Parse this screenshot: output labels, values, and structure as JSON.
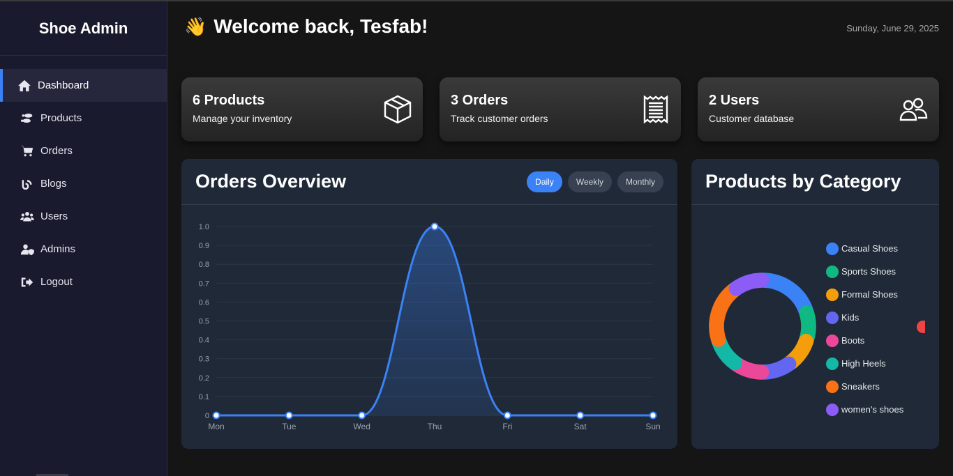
{
  "sidebar": {
    "brand": "Shoe Admin",
    "items": [
      {
        "label": "Dashboard",
        "icon": "home-icon"
      },
      {
        "label": "Products",
        "icon": "shoe-prints-icon"
      },
      {
        "label": "Orders",
        "icon": "cart-icon"
      },
      {
        "label": "Blogs",
        "icon": "blog-icon"
      },
      {
        "label": "Users",
        "icon": "users-icon"
      },
      {
        "label": "Admins",
        "icon": "user-shield-icon"
      },
      {
        "label": "Logout",
        "icon": "logout-icon"
      }
    ],
    "active": "Dashboard"
  },
  "header": {
    "wave": "👋",
    "welcome": "Welcome back, Tesfab!",
    "date": "Sunday, June 29, 2025"
  },
  "stats": [
    {
      "title": "6 Products",
      "subtitle": "Manage your inventory",
      "icon": "box-icon"
    },
    {
      "title": "3 Orders",
      "subtitle": "Track customer orders",
      "icon": "receipt-icon"
    },
    {
      "title": "2 Users",
      "subtitle": "Customer database",
      "icon": "users-outline-icon"
    }
  ],
  "orders": {
    "title": "Orders Overview",
    "tabs": [
      "Daily",
      "Weekly",
      "Monthly"
    ],
    "active_tab": "Daily"
  },
  "category": {
    "title": "Products by Category"
  },
  "colors": {
    "accent": "#3b82f6",
    "card": "#1f2937",
    "line": "#3b82f6"
  },
  "chart_data": [
    {
      "type": "line",
      "categories": [
        "Mon",
        "Tue",
        "Wed",
        "Thu",
        "Fri",
        "Sat",
        "Sun"
      ],
      "series": [
        {
          "values": [
            0,
            0,
            0,
            1,
            0,
            0,
            0
          ]
        }
      ],
      "yticks": [
        "0",
        "0.1",
        "0.2",
        "0.3",
        "0.4",
        "0.5",
        "0.6",
        "0.7",
        "0.8",
        "0.9",
        "1.0"
      ],
      "ylim": [
        0,
        1
      ],
      "grid": true,
      "fill": true
    },
    {
      "type": "pie",
      "labels": [
        "Casual Shoes",
        "Sports Shoes",
        "Formal Shoes",
        "Kids",
        "Boots",
        "High Heels",
        "Sneakers",
        "women's shoes"
      ],
      "values": [
        2,
        1,
        1,
        1,
        1,
        1,
        2,
        1
      ],
      "colors": [
        "#3b82f6",
        "#10b981",
        "#f59e0b",
        "#6366f1",
        "#ec4899",
        "#14b8a6",
        "#f97316",
        "#8b5cf6"
      ],
      "hidden_label": "Red",
      "legend": "right"
    }
  ]
}
